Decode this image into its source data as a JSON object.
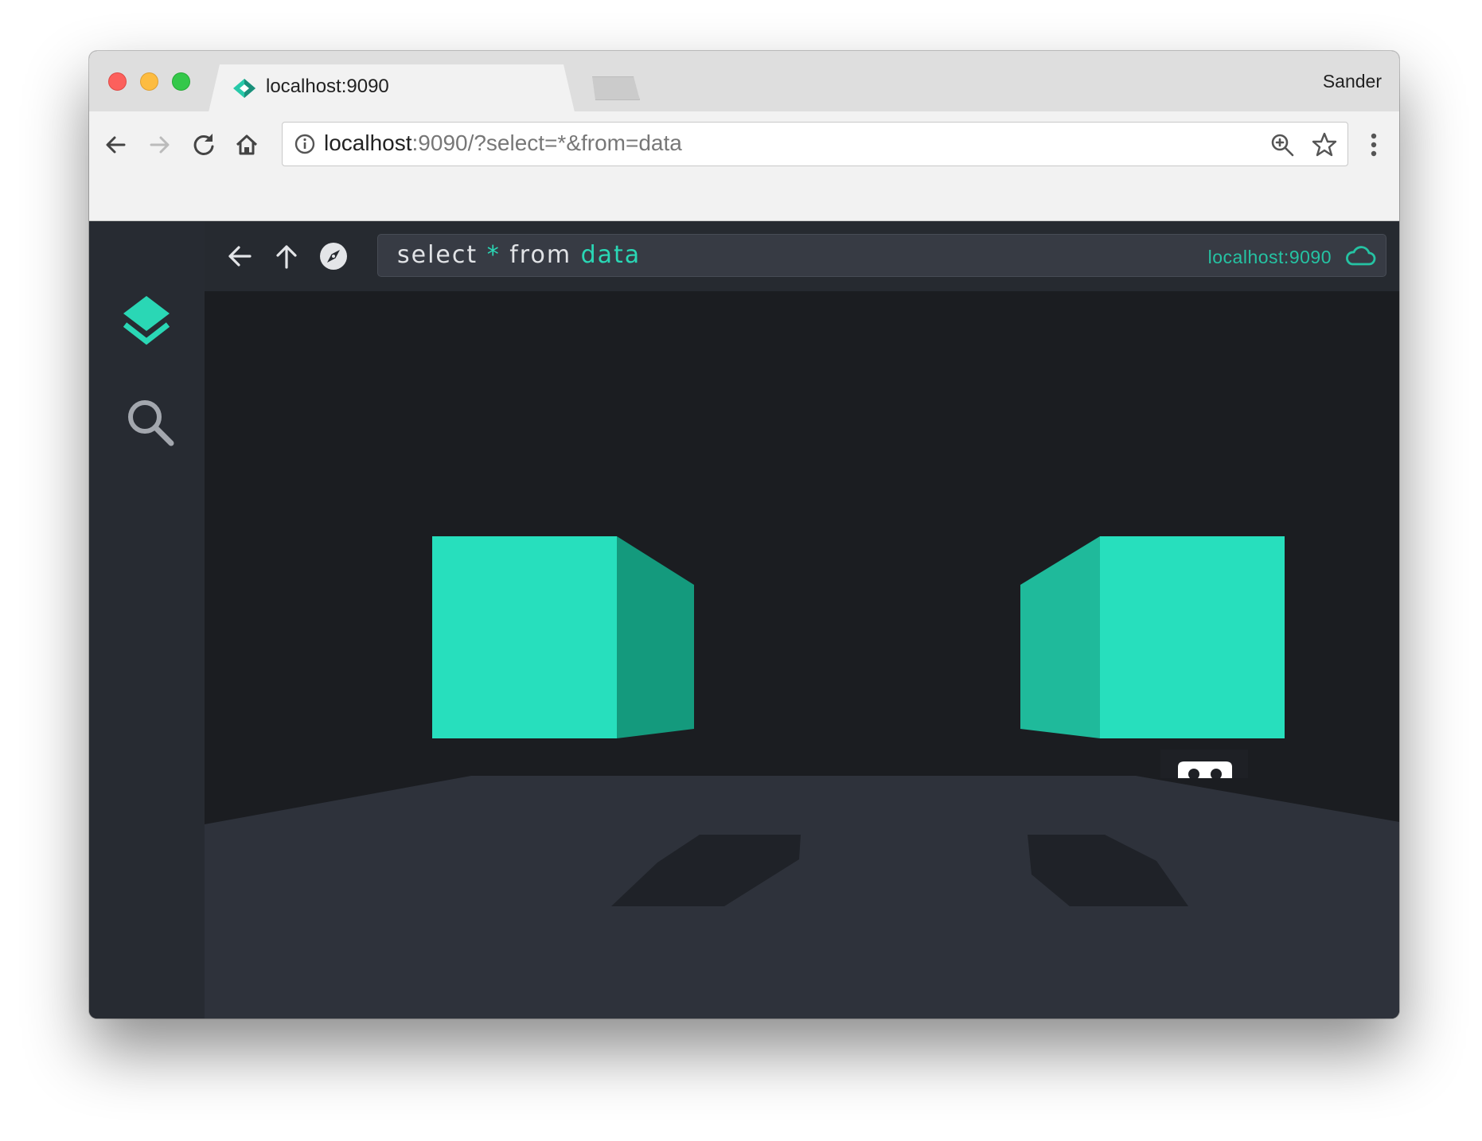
{
  "browser": {
    "tab_title": "localhost:9090",
    "profile_name": "Sander",
    "url_host": "localhost",
    "url_rest": ":9090/?select=*&from=data"
  },
  "app": {
    "query": {
      "keyword_select": "select",
      "star": "*",
      "keyword_from": "from",
      "table": "data"
    },
    "host": "localhost:9090",
    "icons": {
      "sidebar": [
        "layers-icon",
        "search-icon"
      ],
      "nav": [
        "back-arrow-icon",
        "up-arrow-icon",
        "compass-icon"
      ],
      "status": "cloud-icon"
    }
  },
  "colors": {
    "accent": "#2ad7b5",
    "app_background": "#1b1d21",
    "floor": "#2e323b",
    "cube_front": "#27dfbd"
  }
}
